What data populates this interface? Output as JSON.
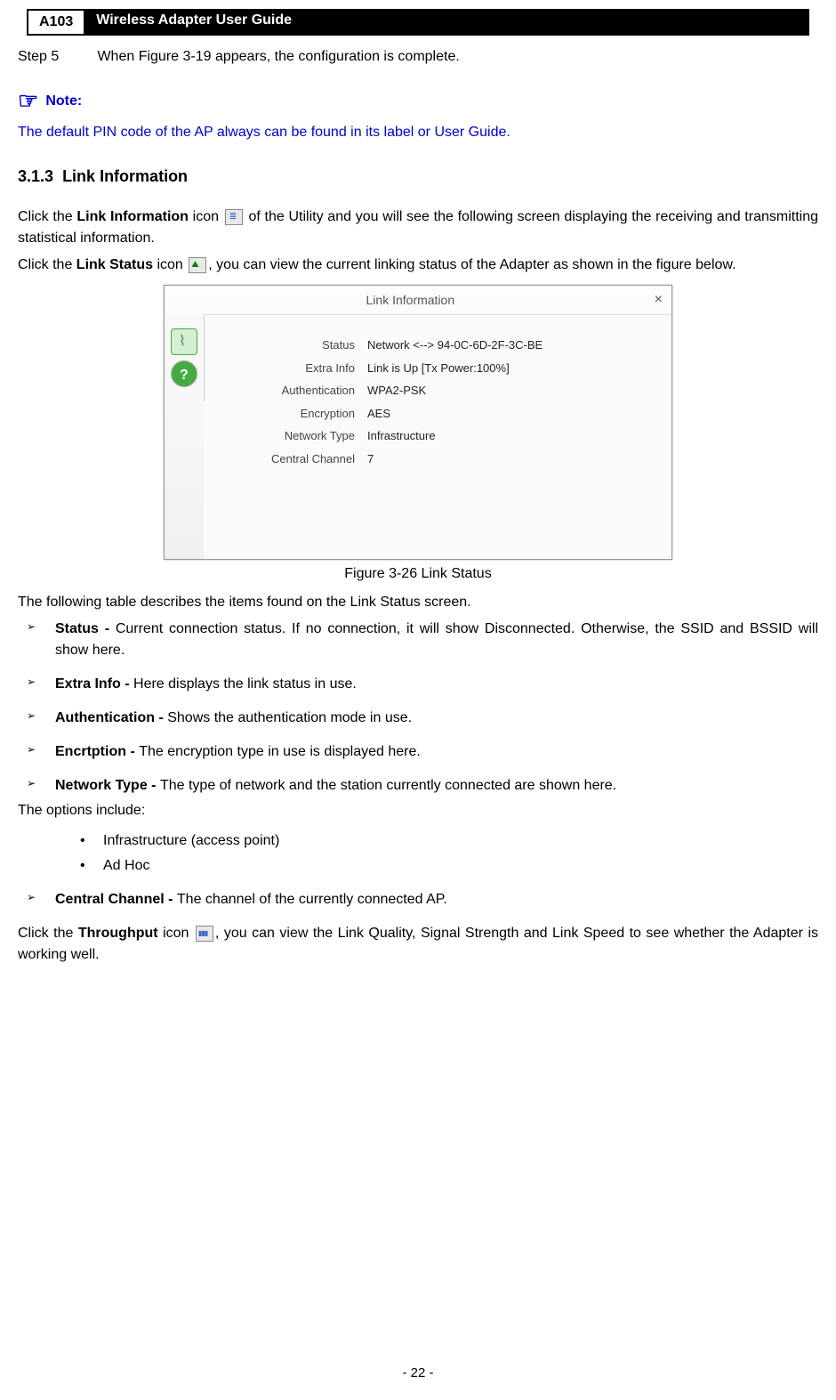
{
  "header": {
    "code": "A103",
    "title": "Wireless Adapter User Guide"
  },
  "step": {
    "label": "Step 5",
    "text": "When Figure 3-19 appears, the configuration is complete."
  },
  "note": {
    "label": "Note:",
    "body": "The default PIN code of the AP always can be found in its label or User Guide."
  },
  "section": {
    "number": "3.1.3",
    "title": "Link Information"
  },
  "para1_a": "Click the ",
  "para1_b1": "Link Information",
  "para1_c": " icon ",
  "para1_d": " of the Utility and you will see the following screen displaying the receiving and transmitting statistical information.",
  "para2_a": "Click the ",
  "para2_b": "Link Status",
  "para2_c": " icon ",
  "para2_d": ", you can view the current linking status of the Adapter as shown in the figure below.",
  "appWindow": {
    "title": "Link Information",
    "rows": [
      {
        "label": "Status",
        "value": "Network <--> 94-0C-6D-2F-3C-BE"
      },
      {
        "label": "Extra Info",
        "value": "Link is Up  [Tx Power:100%]"
      },
      {
        "label": "Authentication",
        "value": "WPA2-PSK"
      },
      {
        "label": "Encryption",
        "value": "AES"
      },
      {
        "label": "Network Type",
        "value": "Infrastructure"
      },
      {
        "label": "Central Channel",
        "value": "7"
      }
    ]
  },
  "figureCaption": "Figure 3-26 Link Status",
  "intro2": "The following table describes the items found on the Link Status screen.",
  "bullets": [
    {
      "bold": "Status - ",
      "text": "Current connection status. If no connection, it will show Disconnected. Otherwise, the SSID and BSSID will show here."
    },
    {
      "bold": "Extra Info - ",
      "text": "Here displays the link status in use."
    },
    {
      "bold": "Authentication - ",
      "text": "Shows the authentication mode in use."
    },
    {
      "bold": "Encrtption - ",
      "text": "The encryption type in use is displayed here."
    },
    {
      "bold": "Network Type - ",
      "text": "The type of network and the station currently connected are shown here."
    }
  ],
  "followon": "The options include:",
  "dots": [
    "Infrastructure (access point)",
    "Ad Hoc"
  ],
  "bullet_last": {
    "bold": "Central Channel - ",
    "text": "The channel of the currently connected AP."
  },
  "para3_a": "Click the ",
  "para3_b": "Throughput",
  "para3_c": " icon ",
  "para3_d": ", you can view the Link Quality, Signal Strength and Link Speed to see whether the Adapter is working well.",
  "pageNumber": "- 22 -"
}
